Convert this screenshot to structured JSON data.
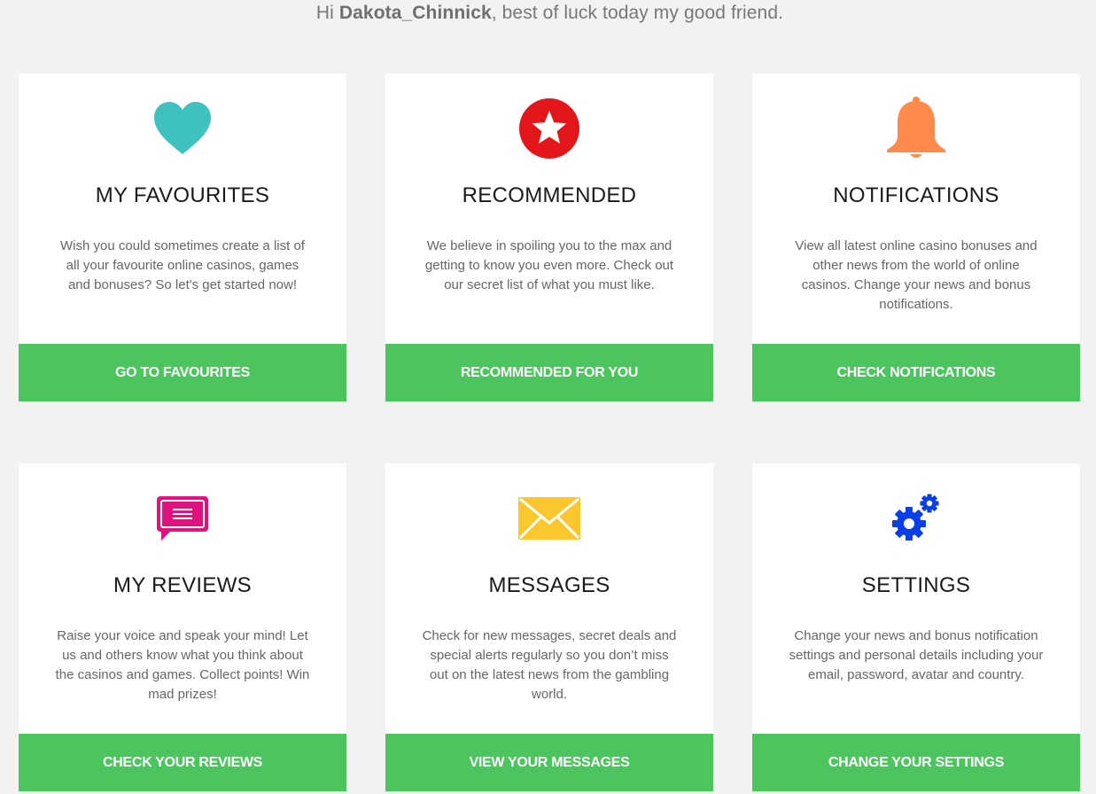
{
  "greeting": {
    "prefix": "Hi ",
    "username": "Dakota_Chinnick",
    "suffix": ", best of luck today my good friend."
  },
  "cards": [
    {
      "icon": "heart-icon",
      "icon_color": "#3fc1bf",
      "title": "MY FAVOURITES",
      "description": "Wish you could sometimes create a list of all your favourite online casinos, games and bonuses? So let's get started now!",
      "button_label": "GO TO FAVOURITES"
    },
    {
      "icon": "star-badge-icon",
      "icon_color": "#e3171a",
      "title": "RECOMMENDED",
      "description": "We believe in spoiling you to the max and getting to know you even more. Check out our secret list of what you must like.",
      "button_label": "RECOMMENDED FOR YOU"
    },
    {
      "icon": "bell-icon",
      "icon_color": "#ff8a4c",
      "title": "NOTIFICATIONS",
      "description": "View all latest online casino bonuses and other news from the world of online casinos. Change your news and bonus notifications.",
      "button_label": "CHECK NOTIFICATIONS"
    },
    {
      "icon": "chat-bubble-icon",
      "icon_color": "#e0137e",
      "title": "MY REVIEWS",
      "description": "Raise your voice and speak your mind! Let us and others know what you think about the casinos and games. Collect points! Win mad prizes!",
      "button_label": "CHECK YOUR REVIEWS"
    },
    {
      "icon": "envelope-icon",
      "icon_color": "#fcc72c",
      "title": "MESSAGES",
      "description": "Check for new messages, secret deals and special alerts regularly so you don’t miss out on the latest news from the gambling world.",
      "button_label": "VIEW YOUR MESSAGES"
    },
    {
      "icon": "gears-icon",
      "icon_color": "#0a3ee6",
      "title": "SETTINGS",
      "description": "Change your news and bonus notification settings and personal details including your email, password, avatar and country.",
      "button_label": "CHANGE YOUR SETTINGS"
    }
  ],
  "colors": {
    "background": "#f2f2f2",
    "button": "#4dc55e",
    "card": "#ffffff"
  }
}
